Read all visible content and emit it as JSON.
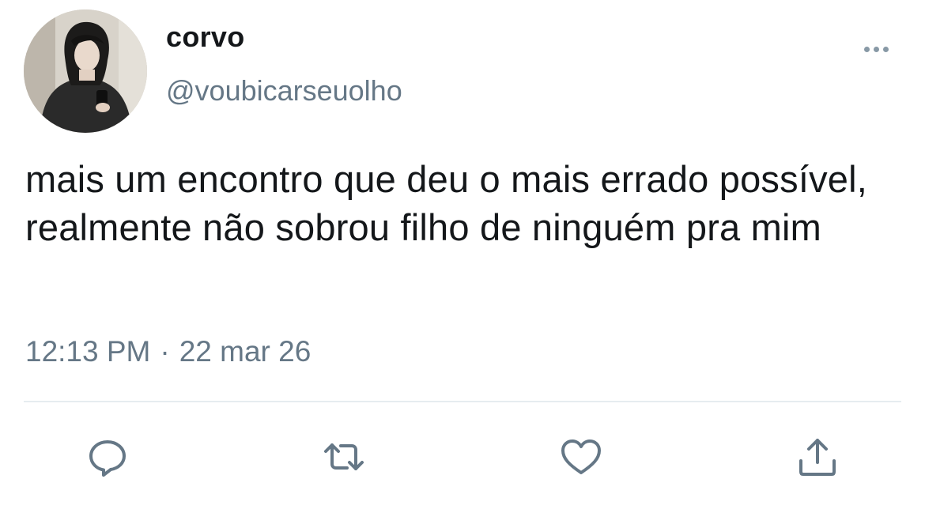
{
  "author": {
    "display_name": "corvo",
    "handle": "@voubicarseuolho",
    "avatar_icon": "profile-photo"
  },
  "tweet": {
    "text": "mais um encontro que deu o mais errado possível, realmente não sobrou filho de ninguém pra mim",
    "time": "12:13 PM",
    "separator": "·",
    "date": "22 mar 26"
  },
  "actions": {
    "reply_icon": "reply-icon",
    "retweet_icon": "retweet-icon",
    "like_icon": "heart-icon",
    "share_icon": "share-icon",
    "more_icon": "more-icon"
  },
  "colors": {
    "text": "#14171a",
    "secondary": "#657786",
    "icon": "#657786",
    "divider": "#e6ecf0"
  }
}
